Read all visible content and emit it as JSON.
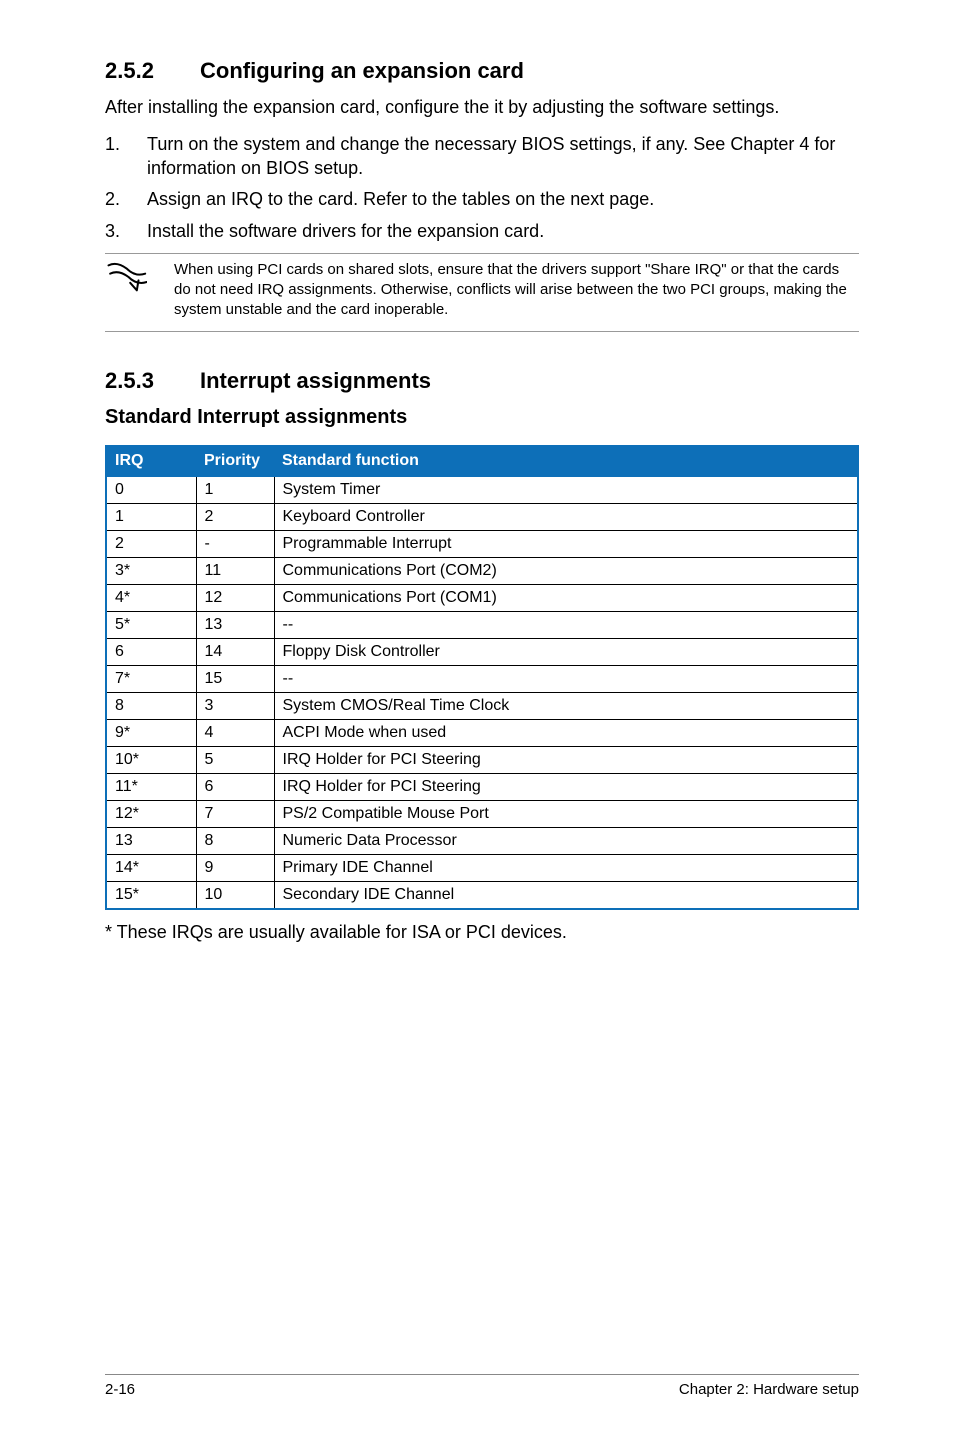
{
  "section_252": {
    "number": "2.5.2",
    "title": "Configuring an expansion card",
    "intro": "After installing the expansion card, configure the it by adjusting the software settings.",
    "steps": [
      "Turn on the system and change the necessary BIOS settings, if any. See Chapter 4 for information on BIOS setup.",
      "Assign an IRQ to the card. Refer to the tables on the next page.",
      "Install the software drivers for the expansion card."
    ],
    "note": "When using PCI cards on shared slots, ensure that the drivers support \"Share IRQ\" or that the cards do not need IRQ assignments. Otherwise, conflicts will arise between the two PCI groups, making the system unstable and the card inoperable."
  },
  "section_253": {
    "number": "2.5.3",
    "title": "Interrupt assignments",
    "sub_heading": "Standard Interrupt assignments",
    "headers": {
      "irq": "IRQ",
      "priority": "Priority",
      "func": "Standard function"
    },
    "rows": [
      {
        "irq": "0",
        "priority": "1",
        "func": "System Timer"
      },
      {
        "irq": "1",
        "priority": "2",
        "func": "Keyboard Controller"
      },
      {
        "irq": "2",
        "priority": "-",
        "func": "Programmable Interrupt"
      },
      {
        "irq": "3*",
        "priority": "11",
        "func": "Communications Port (COM2)"
      },
      {
        "irq": "4*",
        "priority": "12",
        "func": "Communications Port (COM1)"
      },
      {
        "irq": "5*",
        "priority": "13",
        "func": "--"
      },
      {
        "irq": "6",
        "priority": "14",
        "func": "Floppy Disk Controller"
      },
      {
        "irq": "7*",
        "priority": "15",
        "func": "--"
      },
      {
        "irq": "8",
        "priority": "3",
        "func": "System CMOS/Real Time Clock"
      },
      {
        "irq": "9*",
        "priority": "4",
        "func": "ACPI Mode when used"
      },
      {
        "irq": "10*",
        "priority": "5",
        "func": "IRQ Holder for PCI Steering"
      },
      {
        "irq": "11*",
        "priority": "6",
        "func": "IRQ Holder for PCI Steering"
      },
      {
        "irq": "12*",
        "priority": "7",
        "func": "PS/2 Compatible Mouse Port"
      },
      {
        "irq": "13",
        "priority": "8",
        "func": "Numeric Data Processor"
      },
      {
        "irq": "14*",
        "priority": "9",
        "func": "Primary IDE Channel"
      },
      {
        "irq": "15*",
        "priority": "10",
        "func": "Secondary IDE Channel"
      }
    ],
    "footnote": "* These IRQs are usually available for ISA or PCI devices."
  },
  "footer": {
    "left": "2-16",
    "right": "Chapter 2:  Hardware setup"
  }
}
